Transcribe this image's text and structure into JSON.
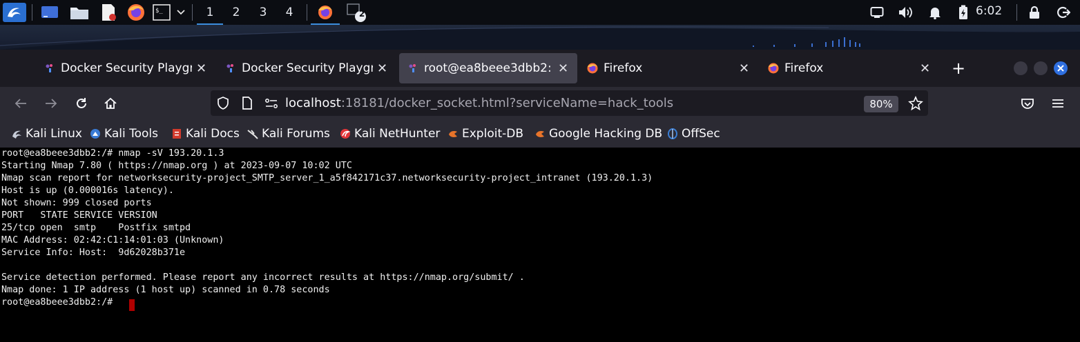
{
  "panel": {
    "workspaces": [
      "1",
      "2",
      "3",
      "4"
    ],
    "active_workspace": "1",
    "terminal_badge": "2",
    "clock": "6:02",
    "icons": [
      "kali-menu-icon",
      "desktop-icon",
      "file-manager-icon",
      "text-editor-icon",
      "firefox-icon",
      "terminal-icon",
      "chevron-down-icon",
      "firefox-window-icon",
      "terminal-window-icon",
      "display-icon",
      "volume-icon",
      "notification-bell-icon",
      "battery-icon",
      "lock-icon",
      "logout-icon"
    ]
  },
  "browser": {
    "tabs": [
      {
        "label": "Docker Security Playground",
        "favicon": "docker-icon",
        "selected": false
      },
      {
        "label": "Docker Security Playground",
        "favicon": "docker-icon",
        "selected": false
      },
      {
        "label": "root@ea8beee3dbb2: /",
        "favicon": "docker-icon",
        "selected": true
      },
      {
        "label": "Firefox",
        "favicon": "firefox-icon",
        "selected": false
      },
      {
        "label": "Firefox",
        "favicon": "firefox-icon",
        "selected": false
      }
    ],
    "new_tab_label": "+",
    "url_host": "localhost",
    "url_rest": ":18181/docker_socket.html?serviceName=hack_tools",
    "zoom": "80%",
    "bookmarks": [
      {
        "label": "Kali Linux",
        "icon": "kali-icon",
        "color": "#9aa4b8"
      },
      {
        "label": "Kali Tools",
        "icon": "kali-tools-icon",
        "color": "#3a7bd5"
      },
      {
        "label": "Kali Docs",
        "icon": "kali-docs-icon",
        "color": "#d23a2c"
      },
      {
        "label": "Kali Forums",
        "icon": "kali-forums-icon",
        "color": "#dddddd"
      },
      {
        "label": "Kali NetHunter",
        "icon": "nethunter-icon",
        "color": "#e2363a"
      },
      {
        "label": "Exploit-DB",
        "icon": "exploit-db-icon",
        "color": "#e8742a"
      },
      {
        "label": "Google Hacking DB",
        "icon": "ghdb-icon",
        "color": "#e8742a"
      },
      {
        "label": "OffSec",
        "icon": "offsec-icon",
        "color": "#3b7fd6"
      }
    ]
  },
  "terminal": {
    "lines": [
      "root@ea8beee3dbb2:/# nmap -sV 193.20.1.3",
      "Starting Nmap 7.80 ( https://nmap.org ) at 2023-09-07 10:02 UTC",
      "Nmap scan report for networksecurity-project_SMTP_server_1_a5f842171c37.networksecurity-project_intranet (193.20.1.3)",
      "Host is up (0.000016s latency).",
      "Not shown: 999 closed ports",
      "PORT   STATE SERVICE VERSION",
      "25/tcp open  smtp    Postfix smtpd",
      "MAC Address: 02:42:C1:14:01:03 (Unknown)",
      "Service Info: Host:  9d62028b371e",
      "",
      "Service detection performed. Please report any incorrect results at https://nmap.org/submit/ .",
      "Nmap done: 1 IP address (1 host up) scanned in 0.78 seconds",
      "root@ea8beee3dbb2:/# "
    ]
  },
  "colors": {
    "accent": "#3b8ddd",
    "tab_selected": "#42414d",
    "toolbar": "#2b2a33",
    "cursor": "#b00000"
  }
}
